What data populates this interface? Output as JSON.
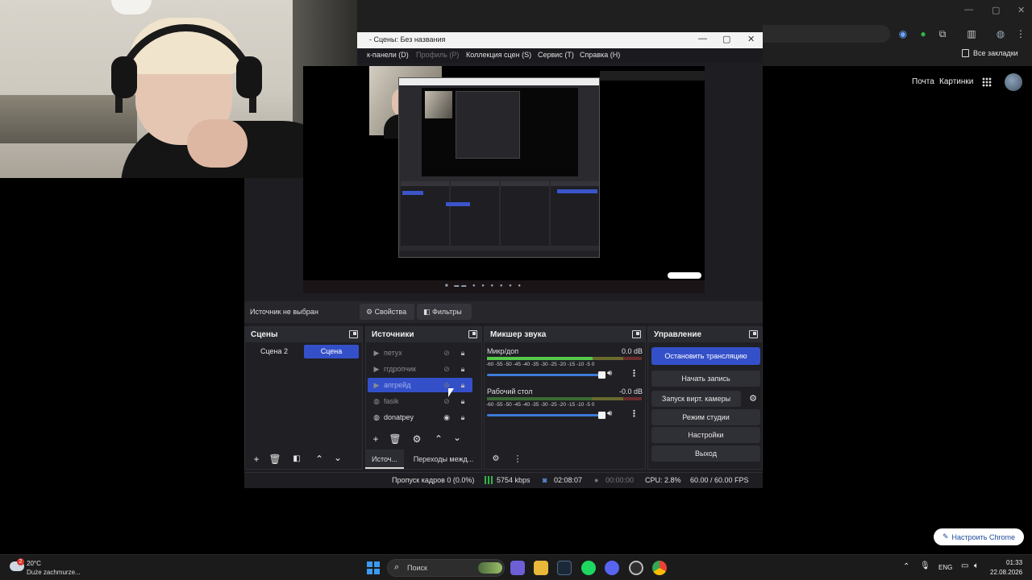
{
  "chrome": {
    "bookmarks_all": "Все закладки",
    "mail_link": "Почта",
    "images_link": "Картинки",
    "customize_button": "Настроить Chrome",
    "accent": "#1a4a9a"
  },
  "obs": {
    "window_title": "- Сцены: Без названия",
    "menu": {
      "docks": "к-панели (D)",
      "profile": "Профиль (P)",
      "scene_collection": "Коллекция сцен (S)",
      "tools": "Сервис (T)",
      "help": "Справка (H)"
    },
    "source_bar": {
      "no_source": "Источник не выбран",
      "properties": "Свойства",
      "filters": "Фильтры"
    },
    "scenes": {
      "title": "Сцены",
      "items": [
        {
          "label": "Сцена 2",
          "active": false
        },
        {
          "label": "Сцена",
          "active": true
        }
      ]
    },
    "sources": {
      "title": "Источники",
      "items": [
        {
          "label": "петух",
          "icon": "play-icon",
          "visible": false
        },
        {
          "label": "ггдропчик",
          "icon": "play-icon",
          "visible": false
        },
        {
          "label": "апгрейд",
          "icon": "play-icon",
          "visible": false,
          "selected": true
        },
        {
          "label": "fasik",
          "icon": "browser-icon",
          "visible": false
        },
        {
          "label": "donatpey",
          "icon": "browser-icon",
          "visible": true
        }
      ],
      "tab_sources": "Источ...",
      "tab_transitions": "Переходы межд..."
    },
    "mixer": {
      "title": "Микшер звука",
      "channels": [
        {
          "name": "Микр/доп",
          "db": "0.0 dB",
          "level": 0.68,
          "volume": 0.97
        },
        {
          "name": "Рабочий стол",
          "db": "-0.0 dB",
          "level": 0.0,
          "volume": 0.97
        }
      ],
      "scale": "-60 -55 -50 -45 -40 -35 -30 -25 -20 -15 -10 -5 0"
    },
    "controls": {
      "title": "Управление",
      "stop_stream": "Остановить трансляцию",
      "start_record": "Начать запись",
      "virtual_cam": "Запуск вирт. камеры",
      "studio_mode": "Режим студии",
      "settings": "Настройки",
      "exit": "Выход",
      "accent": "#3450c8"
    },
    "status": {
      "dropped_frames": "Пропуск кадров 0 (0.0%)",
      "bitrate": "5754 kbps",
      "stream_time": "02:08:07",
      "record_time": "00:00:00",
      "cpu": "CPU: 2.8%",
      "fps": "60.00 / 60.00 FPS"
    }
  },
  "taskbar": {
    "weather_badge": "2",
    "weather_temp": "20°C",
    "weather_desc": "Duże zachmurze...",
    "search_placeholder": "Поиск",
    "lang": "ENG",
    "time": "01:33",
    "date": "22.08.2026"
  }
}
